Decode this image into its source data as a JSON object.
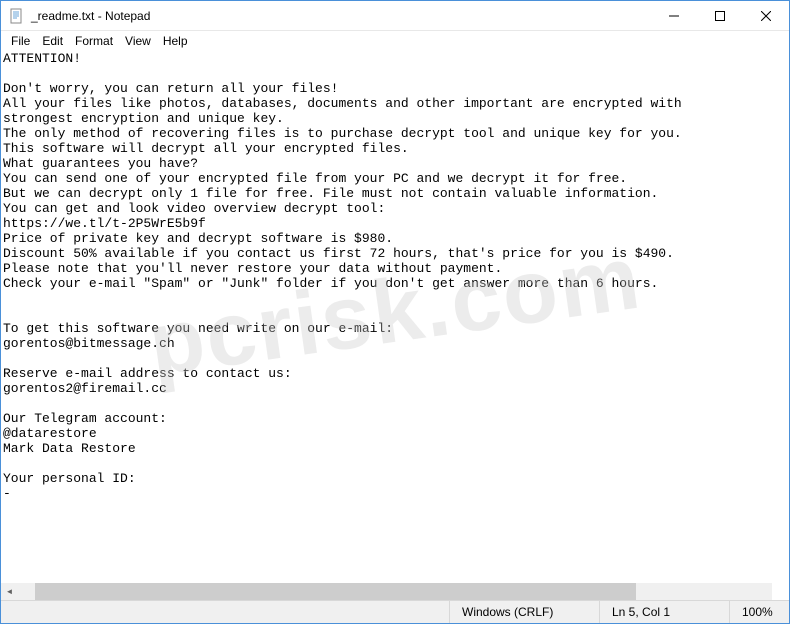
{
  "window": {
    "title": "_readme.txt - Notepad"
  },
  "menu": {
    "file": "File",
    "edit": "Edit",
    "format": "Format",
    "view": "View",
    "help": "Help"
  },
  "document": {
    "text": "ATTENTION!\n\nDon't worry, you can return all your files!\nAll your files like photos, databases, documents and other important are encrypted with\nstrongest encryption and unique key.\nThe only method of recovering files is to purchase decrypt tool and unique key for you.\nThis software will decrypt all your encrypted files.\nWhat guarantees you have?\nYou can send one of your encrypted file from your PC and we decrypt it for free.\nBut we can decrypt only 1 file for free. File must not contain valuable information.\nYou can get and look video overview decrypt tool:\nhttps://we.tl/t-2P5WrE5b9f\nPrice of private key and decrypt software is $980.\nDiscount 50% available if you contact us first 72 hours, that's price for you is $490.\nPlease note that you'll never restore your data without payment.\nCheck your e-mail \"Spam\" or \"Junk\" folder if you don't get answer more than 6 hours.\n\n\nTo get this software you need write on our e-mail:\ngorentos@bitmessage.ch\n\nReserve e-mail address to contact us:\ngorentos2@firemail.cc\n\nOur Telegram account:\n@datarestore\nMark Data Restore\n\nYour personal ID:\n-"
  },
  "statusbar": {
    "encoding": "Windows (CRLF)",
    "position": "Ln 5, Col 1",
    "zoom": "100%"
  },
  "watermark": "pcrisk.com"
}
